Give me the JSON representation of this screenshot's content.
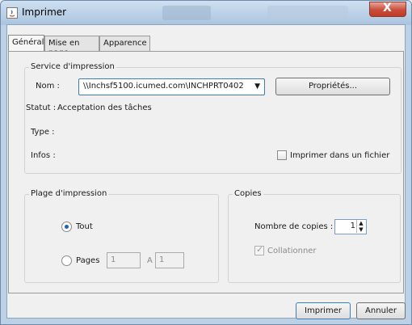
{
  "window": {
    "title": "Imprimer",
    "close_symbol": "X"
  },
  "tabs": [
    {
      "label": "Général"
    },
    {
      "label": "Mise en page"
    },
    {
      "label": "Apparence"
    }
  ],
  "print_service": {
    "legend": "Service d'impression",
    "name_label": "Nom :",
    "name_value": "\\\\Inchsf5100.icumed.com\\INCHPRT0402",
    "properties_button": "Propriétés...",
    "status_label": "Statut :",
    "status_value": "Acceptation des tâches",
    "type_label": "Type :",
    "info_label": "Infos :",
    "print_to_file_label": "Imprimer dans un fichier",
    "print_to_file_checked": false
  },
  "print_range": {
    "legend": "Plage d'impression",
    "all_label": "Tout",
    "all_selected": true,
    "pages_label": "Pages",
    "pages_from": "1",
    "to_label": "A",
    "pages_to": "1"
  },
  "copies": {
    "legend": "Copies",
    "count_label": "Nombre de copies :",
    "count_value": "1",
    "collate_label": "Collationner",
    "collate_checked": true
  },
  "buttons": {
    "print": "Imprimer",
    "cancel": "Annuler"
  }
}
